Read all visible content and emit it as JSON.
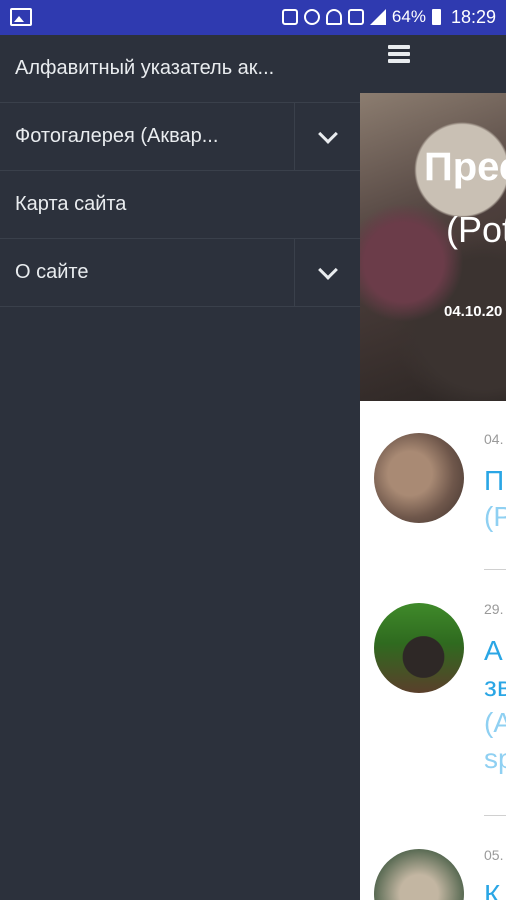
{
  "statusbar": {
    "icons": [
      "gallery-icon",
      "sim-icon",
      "alarm-icon",
      "wifi-icon",
      "data-icon",
      "signal-icon",
      "battery-icon"
    ],
    "battery": "64%",
    "time": "18:29"
  },
  "drawer": {
    "items": [
      {
        "label": "Алфавитный указатель ак...",
        "expandable": false
      },
      {
        "label": "Фотогалерея (Аквар...",
        "expandable": true
      },
      {
        "label": "Карта сайта",
        "expandable": false
      },
      {
        "label": "О сайте",
        "expandable": true
      }
    ]
  },
  "main": {
    "hero": {
      "title": "Прес",
      "subtitle": "(Pot",
      "date": "04.10.20"
    },
    "posts": [
      {
        "date": "04.",
        "title": "П",
        "subtitle": "(P"
      },
      {
        "date": "29.",
        "title": "A",
        "title2": "зв",
        "subtitle": "(A",
        "subtitle2": "sp"
      },
      {
        "date": "05.",
        "title": "К"
      }
    ]
  },
  "colors": {
    "drawer_bg": "#2c313c",
    "statusbar_bg": "#2f3ab0",
    "link": "#2aa6e5"
  }
}
